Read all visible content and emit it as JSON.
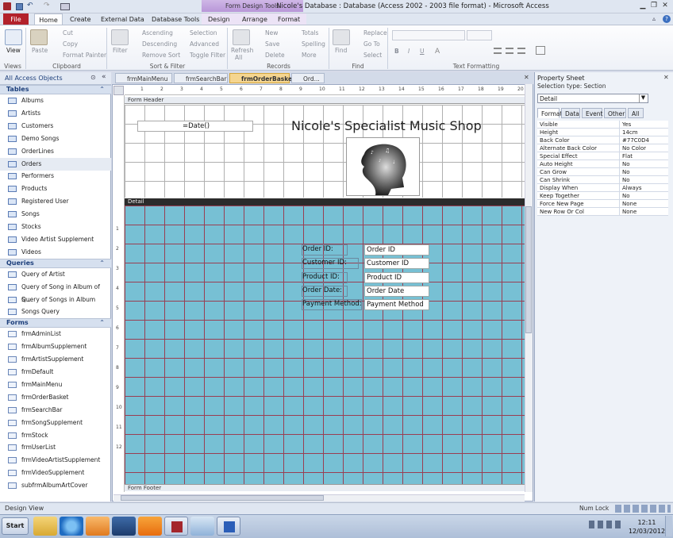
{
  "window": {
    "title": "Nicole's Database : Database (Access 2002 - 2003 file format) - Microsoft Access",
    "contextual_title": "Form Design Tools",
    "controls": {
      "minimize": "▁",
      "restore": "❐",
      "close": "✕"
    }
  },
  "ribbon_tabs": [
    "File",
    "Home",
    "Create",
    "External Data",
    "Database Tools",
    "Design",
    "Arrange",
    "Format"
  ],
  "ribbon": {
    "views": {
      "view": "View",
      "group": "Views"
    },
    "clipboard": {
      "paste": "Paste",
      "cut": "Cut",
      "copy": "Copy",
      "format_painter": "Format Painter",
      "group": "Clipboard"
    },
    "sort_filter": {
      "filter": "Filter",
      "ascending": "Ascending",
      "descending": "Descending",
      "remove_sort": "Remove Sort",
      "selection": "Selection",
      "advanced": "Advanced",
      "toggle_filter": "Toggle Filter",
      "group": "Sort & Filter"
    },
    "records": {
      "refresh": "Refresh",
      "refresh_all": "All",
      "new": "New",
      "save": "Save",
      "delete": "Delete",
      "totals": "Totals",
      "spelling": "Spelling",
      "more": "More",
      "group": "Records"
    },
    "find": {
      "find": "Find",
      "replace": "Replace",
      "goto": "Go To",
      "select": "Select",
      "group": "Find"
    },
    "text_formatting": {
      "bold": "B",
      "italic": "I",
      "underline": "U",
      "group": "Text Formatting"
    }
  },
  "nav": {
    "header": "All Access Objects",
    "tables_label": "Tables",
    "tables": [
      "Albums",
      "Artists",
      "Customers",
      "Demo Songs",
      "OrderLines",
      "Orders",
      "Performers",
      "Products",
      "Registered User",
      "Songs",
      "Stocks",
      "Video Artist Supplement",
      "Videos"
    ],
    "queries_label": "Queries",
    "queries": [
      "Query of Artist",
      "Query of Song in Album of S...",
      "Query of Songs in Album",
      "Songs Query"
    ],
    "forms_label": "Forms",
    "forms": [
      "frmAdminList",
      "frmAlbumSupplement",
      "frmArtistSupplement",
      "frmDefault",
      "frmMainMenu",
      "frmOrderBasket",
      "frmSearchBar",
      "frmSongSupplement",
      "frmStock",
      "frmUserList",
      "frmVideoArtistSupplement",
      "frmVideoSupplement",
      "subfrmAlbumArtCover"
    ]
  },
  "doc_tabs": [
    "frmMainMenu",
    "frmSearchBar",
    "frmOrderBasket",
    "Ord..."
  ],
  "form": {
    "header_band": "Form Header",
    "detail_band": "Detail",
    "footer_band": "Form Footer",
    "date_control": "=Date()",
    "title": "Nicole's Specialist Music Shop",
    "fields": [
      {
        "label": "Order ID:",
        "value": "Order ID"
      },
      {
        "label": "Customer ID:",
        "value": "Customer ID"
      },
      {
        "label": "Product ID:",
        "value": "Product ID"
      },
      {
        "label": "Order Date:",
        "value": "Order Date"
      },
      {
        "label": "Payment Method:",
        "value": "Payment Method"
      }
    ],
    "ruler_numbers": [
      "1",
      "2",
      "3",
      "4",
      "5",
      "6",
      "7",
      "8",
      "9",
      "10",
      "11",
      "12",
      "13",
      "14",
      "15",
      "16",
      "17",
      "18",
      "19",
      "20"
    ],
    "detail_color": "#77c0d4"
  },
  "property_sheet": {
    "title": "Property Sheet",
    "selection_type": "Selection type:  Section",
    "selected": "Detail",
    "tabs": [
      "Format",
      "Data",
      "Event",
      "Other",
      "All"
    ],
    "rows": [
      {
        "name": "Visible",
        "value": "Yes"
      },
      {
        "name": "Height",
        "value": "14cm"
      },
      {
        "name": "Back Color",
        "value": "#77C0D4"
      },
      {
        "name": "Alternate Back Color",
        "value": "No Color"
      },
      {
        "name": "Special Effect",
        "value": "Flat"
      },
      {
        "name": "Auto Height",
        "value": "No"
      },
      {
        "name": "Can Grow",
        "value": "No"
      },
      {
        "name": "Can Shrink",
        "value": "No"
      },
      {
        "name": "Display When",
        "value": "Always"
      },
      {
        "name": "Keep Together",
        "value": "No"
      },
      {
        "name": "Force New Page",
        "value": "None"
      },
      {
        "name": "New Row Or Col",
        "value": "None"
      }
    ]
  },
  "status": {
    "left": "Design View",
    "numlock": "Num Lock"
  },
  "taskbar": {
    "start": "Start",
    "time": "12:11",
    "date": "12/03/2012"
  }
}
